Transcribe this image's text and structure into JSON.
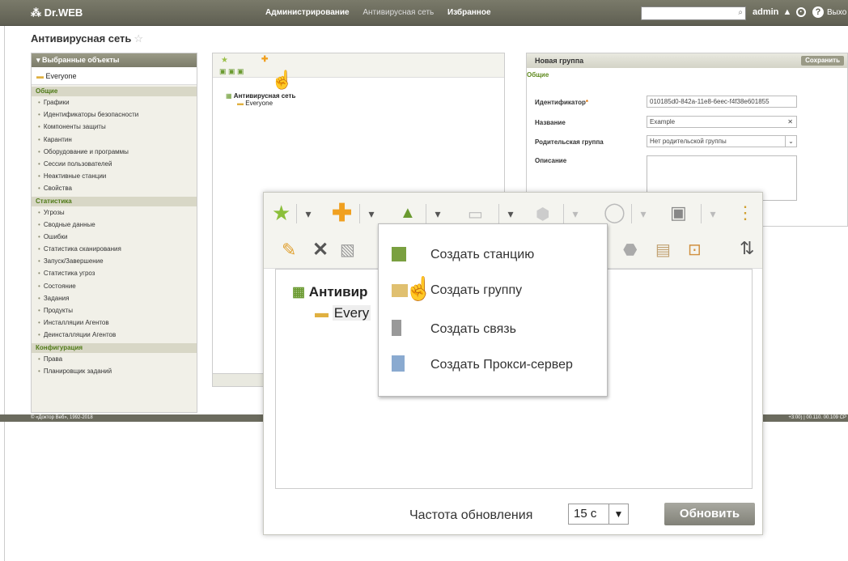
{
  "topbar": {
    "logo": "Dr.WEB",
    "nav": [
      "Администрирование",
      "Антивирусная сеть",
      "Избранное"
    ],
    "user": "admin",
    "exit": "Выхо"
  },
  "page": {
    "title": "Антивирусная сеть"
  },
  "sidebar": {
    "header": "Выбранные объекты",
    "selected": "Everyone",
    "sections": [
      {
        "title": "Общие",
        "items": [
          "Графики",
          "Идентификаторы безопасности",
          "Компоненты защиты",
          "Карантин",
          "Оборудование и программы",
          "Сессии пользователей",
          "Неактивные станции",
          "Свойства"
        ]
      },
      {
        "title": "Статистика",
        "items": [
          "Угрозы",
          "Сводные данные",
          "Ошибки",
          "Статистика сканирования",
          "Запуск/Завершение",
          "Статистика угроз",
          "Состояние",
          "Задания",
          "Продукты",
          "Инсталляции Агентов",
          "Деинсталляции Агентов"
        ]
      },
      {
        "title": "Конфигурация",
        "items": [
          "Права",
          "Планировщик заданий"
        ]
      }
    ]
  },
  "middle": {
    "tree_root": "Антивирусная сеть",
    "tree_child": "Everyone"
  },
  "right_panel": {
    "title": "Новая группа",
    "save_label": "Сохранить",
    "section": "Общие",
    "id_label": "Идентификатор",
    "id_value": "010185d0-842a-11e8-6eec-f4f38e601855",
    "name_label": "Название",
    "name_value": "Example",
    "parent_label": "Родительская группа",
    "parent_value": "Нет родительской группы",
    "desc_label": "Описание"
  },
  "footer": {
    "copyright": "© «Доктор Веб», 1992-2018",
    "right": "+3:00) | 00.110. 00.109 CP"
  },
  "zoom": {
    "tree_root": "Антивир",
    "tree_child": "Every",
    "refresh_label": "Частота обновления",
    "refresh_value": "15 с",
    "refresh_button": "Обновить"
  },
  "menu": {
    "items": [
      "Создать станцию",
      "Создать группу",
      "Создать связь",
      "Создать Прокси-сервер"
    ]
  }
}
